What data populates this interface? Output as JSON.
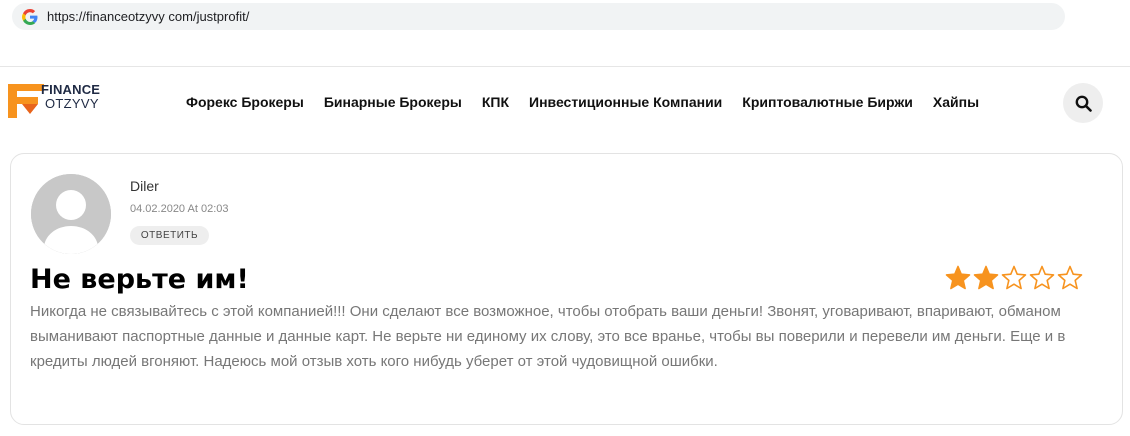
{
  "browser": {
    "url": "https://financeotzyvy com/justprofit/",
    "favicon_icon": "google-g-icon"
  },
  "header": {
    "logo": {
      "line1": "FINANCE",
      "line2": "OTZYVY",
      "accent_color": "#f7931e",
      "text_color": "#1f2a44"
    },
    "nav": [
      {
        "label": "Форекс Брокеры"
      },
      {
        "label": "Бинарные Брокеры"
      },
      {
        "label": "КПК"
      },
      {
        "label": "Инвестиционные Компании"
      },
      {
        "label": "Криптовалютные Биржи"
      },
      {
        "label": "Хайпы"
      }
    ],
    "search_icon": "search-icon"
  },
  "review": {
    "author": "Diler",
    "date": "04.02.2020 At 02:03",
    "reply_label": "ОТВЕТИТЬ",
    "title": "Не верьте им!",
    "rating": 2,
    "rating_max": 5,
    "star_color": "#f7931e",
    "body": "Никогда не связывайтесь с этой компанией!!! Они сделают все возможное, чтобы отобрать ваши деньги! Звонят, уговаривают, впаривают, обманом выманивают паспортные данные и данные карт. Не верьте ни единому их слову, это все вранье, чтобы вы поверили и перевели им деньги. Еще и в кредиты людей вгоняют. Надеюсь мой отзыв хоть кого нибудь уберет от этой чудовищной ошибки."
  }
}
